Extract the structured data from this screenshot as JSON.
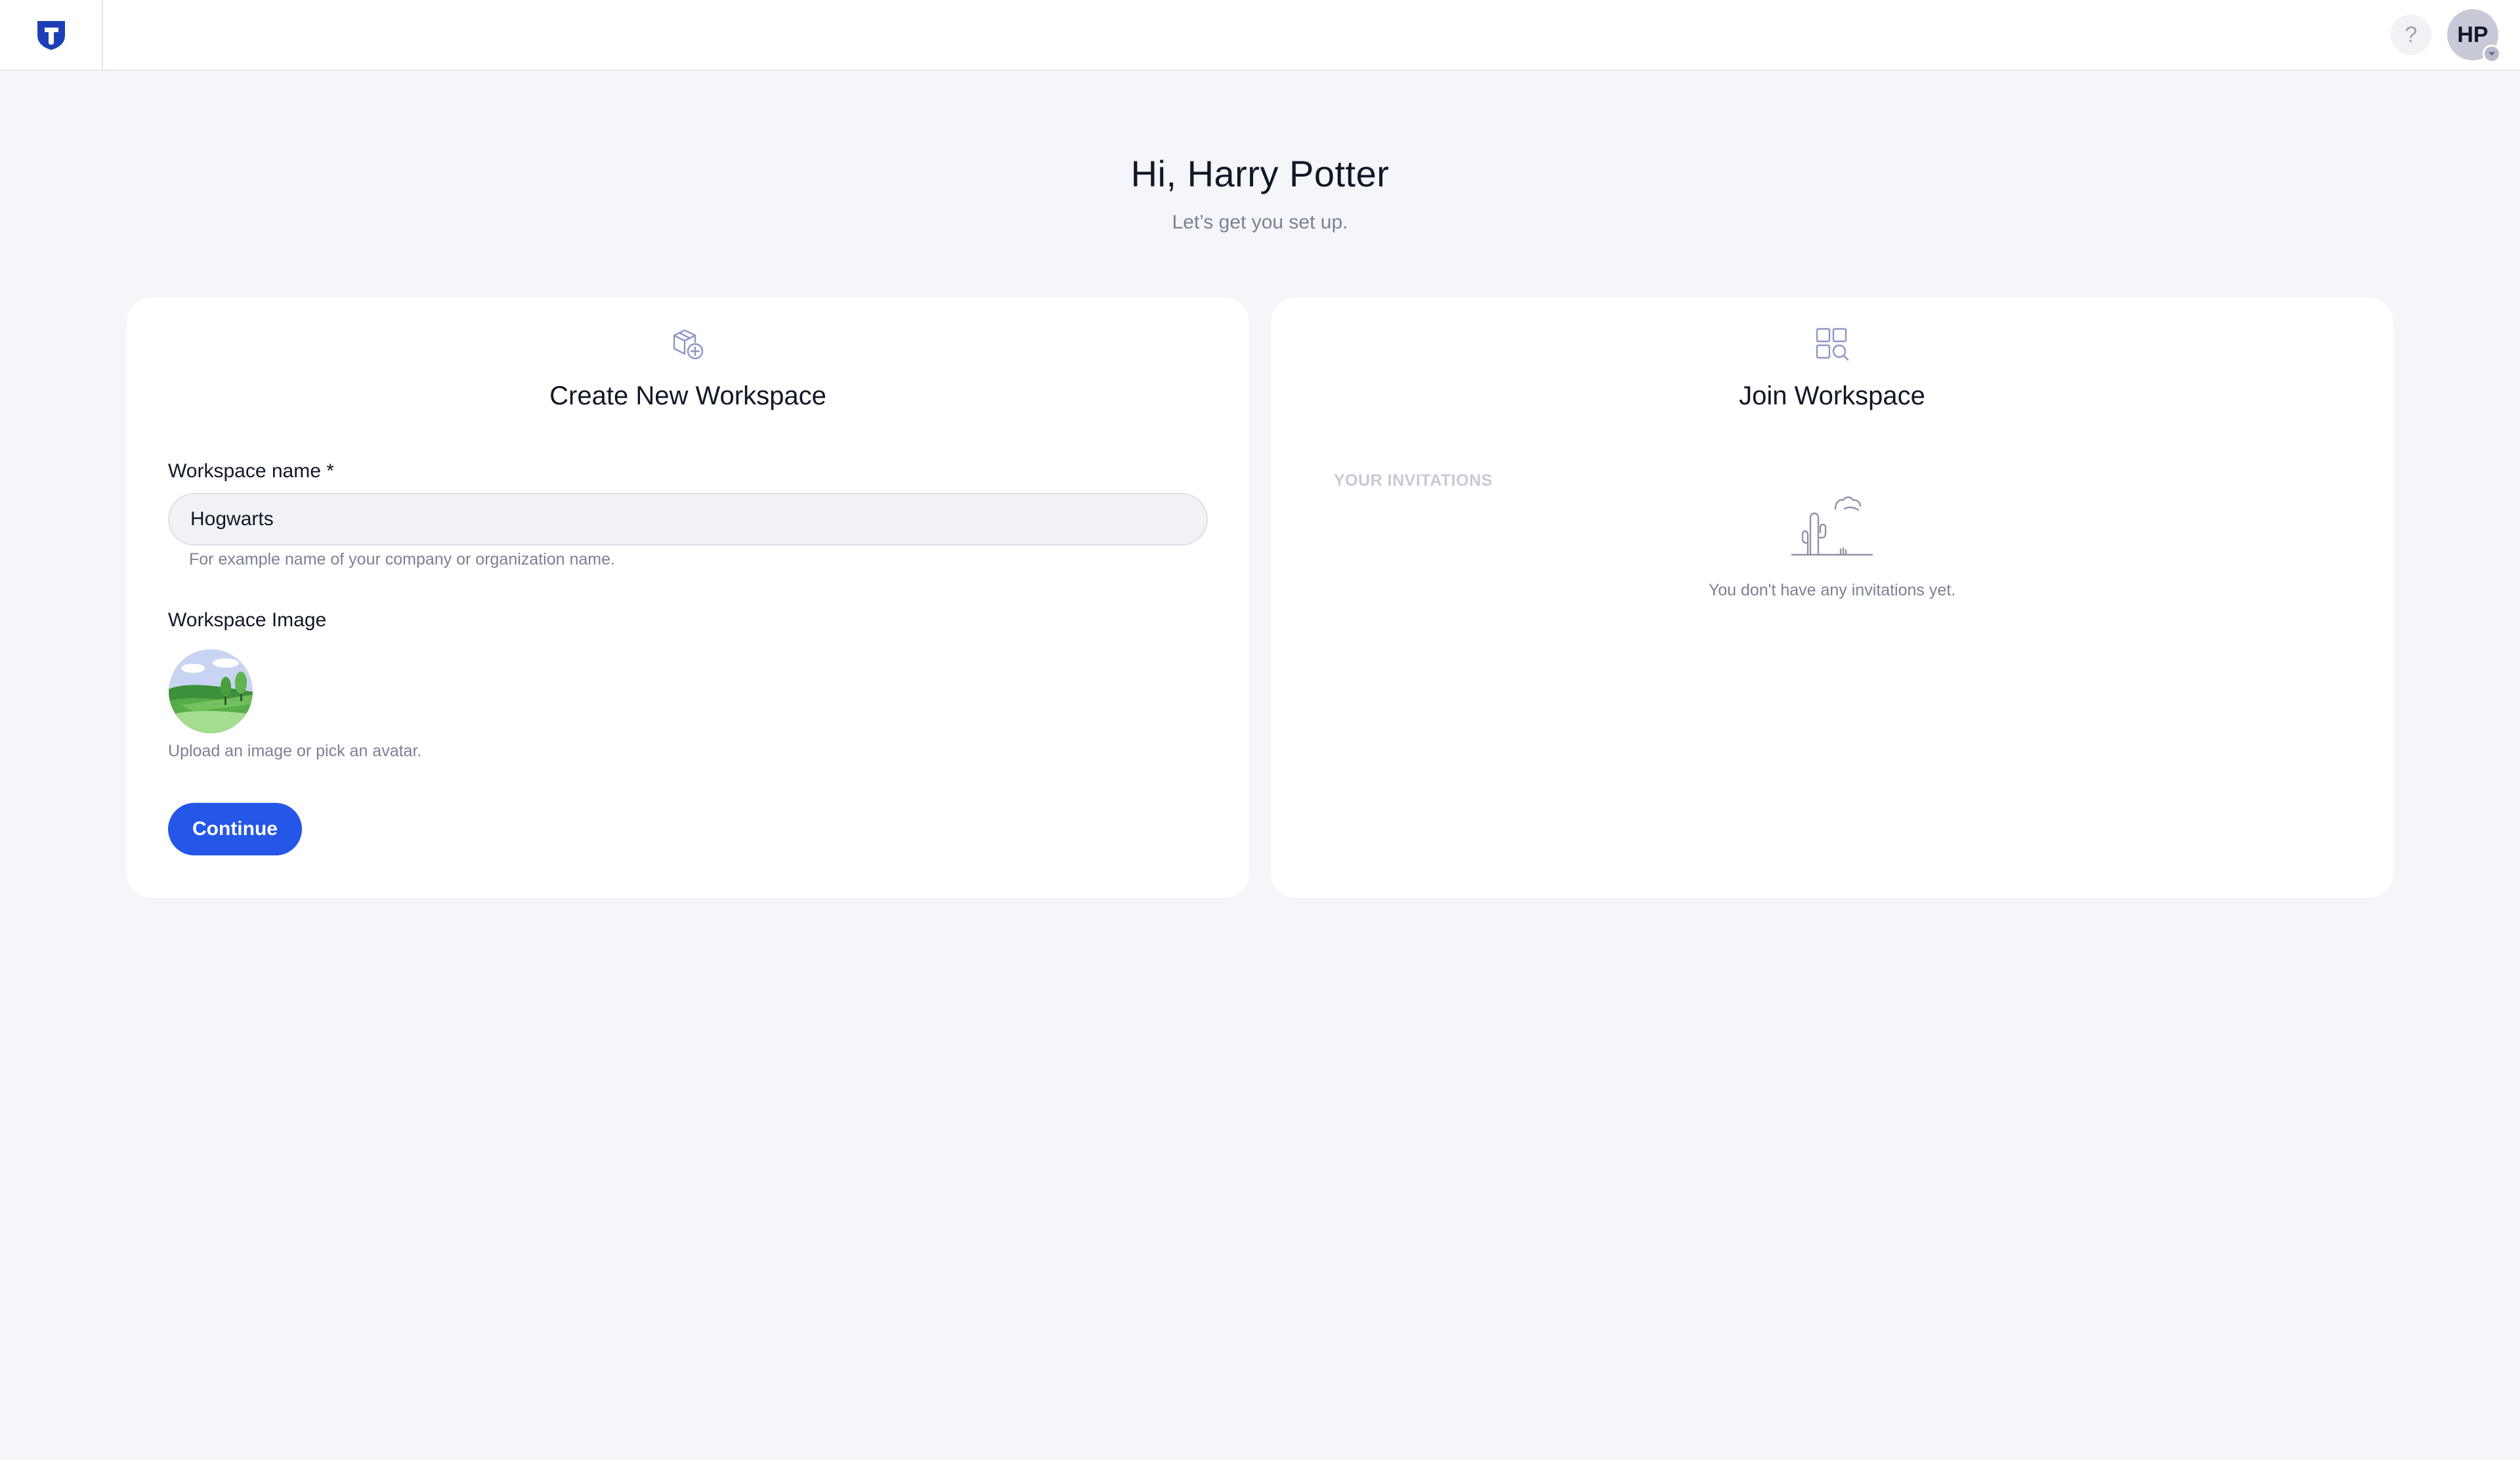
{
  "app": {
    "brand_color": "#1d3fb5",
    "accent_color": "#2456e8"
  },
  "topbar": {
    "logo_icon": "shield-logo-icon",
    "help_label": "?",
    "avatar_initials": "HP"
  },
  "header": {
    "greeting": "Hi, Harry Potter",
    "subtitle": "Let’s get you set up."
  },
  "create_card": {
    "icon": "cube-plus-icon",
    "title": "Create New Workspace",
    "name_label": "Workspace name *",
    "name_value": "Hogwarts",
    "name_hint": "For example name of your company or organization name.",
    "image_label": "Workspace Image",
    "image_icon": "landscape-avatar-icon",
    "image_hint": "Upload an image or pick an avatar.",
    "continue_label": "Continue"
  },
  "join_card": {
    "icon": "grid-search-icon",
    "title": "Join Workspace",
    "invitations_heading": "YOUR INVITATIONS",
    "empty_icon": "cactus-illustration-icon",
    "empty_text": "You don't have any invitations yet."
  }
}
